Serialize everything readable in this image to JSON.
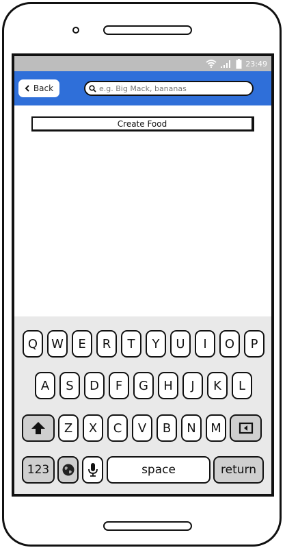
{
  "status_bar": {
    "time": "23:49",
    "icons": [
      "wifi-icon",
      "signal-icon",
      "battery-icon"
    ]
  },
  "nav": {
    "back_label": "Back",
    "search_placeholder": "e.g. Big Mack, bananas",
    "search_value": ""
  },
  "main": {
    "create_food_label": "Create Food"
  },
  "keyboard": {
    "row1": [
      "Q",
      "W",
      "E",
      "R",
      "T",
      "Y",
      "U",
      "I",
      "O",
      "P"
    ],
    "row2": [
      "A",
      "S",
      "D",
      "F",
      "G",
      "H",
      "J",
      "K",
      "L"
    ],
    "row3": [
      "Z",
      "X",
      "C",
      "V",
      "B",
      "N",
      "M"
    ],
    "numbers_label": "123",
    "space_label": "space",
    "return_label": "return"
  },
  "colors": {
    "nav_background": "#2f6fd9",
    "status_bar": "#bdbdbd",
    "keyboard_background": "#e9e9e9"
  }
}
